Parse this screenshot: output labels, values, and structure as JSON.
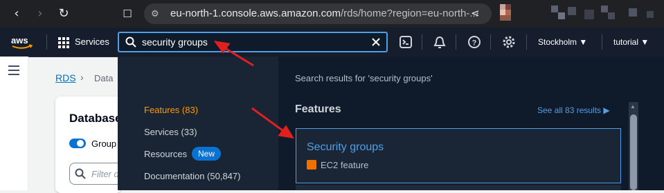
{
  "browser": {
    "url_host": "eu-north-1.console.aws.amazon.com",
    "url_rest": "/rds/home?region=eu-north-..."
  },
  "nav": {
    "services": "Services",
    "search_value": "security groups",
    "region": "Stockholm",
    "account": "tutorial"
  },
  "page": {
    "breadcrumb_root": "RDS",
    "breadcrumb_2": "Data",
    "card_title": "Database",
    "toggle_label": "Group",
    "filter_placeholder": "Filter d"
  },
  "search": {
    "results_for": "Search results for 'security groups'",
    "categories": [
      {
        "label": "Features (83)"
      },
      {
        "label": "Services (33)"
      },
      {
        "label": "Resources"
      },
      {
        "label": "Documentation (50,847)"
      }
    ],
    "new_badge": "New",
    "section_title": "Features",
    "see_all": "See all 83 results",
    "result_title": "Security groups",
    "result_subtitle": "EC2 feature"
  },
  "colors": {
    "accent_blue": "#539fe5",
    "active_orange": "#ff9900",
    "arrow_red": "#e02020"
  }
}
